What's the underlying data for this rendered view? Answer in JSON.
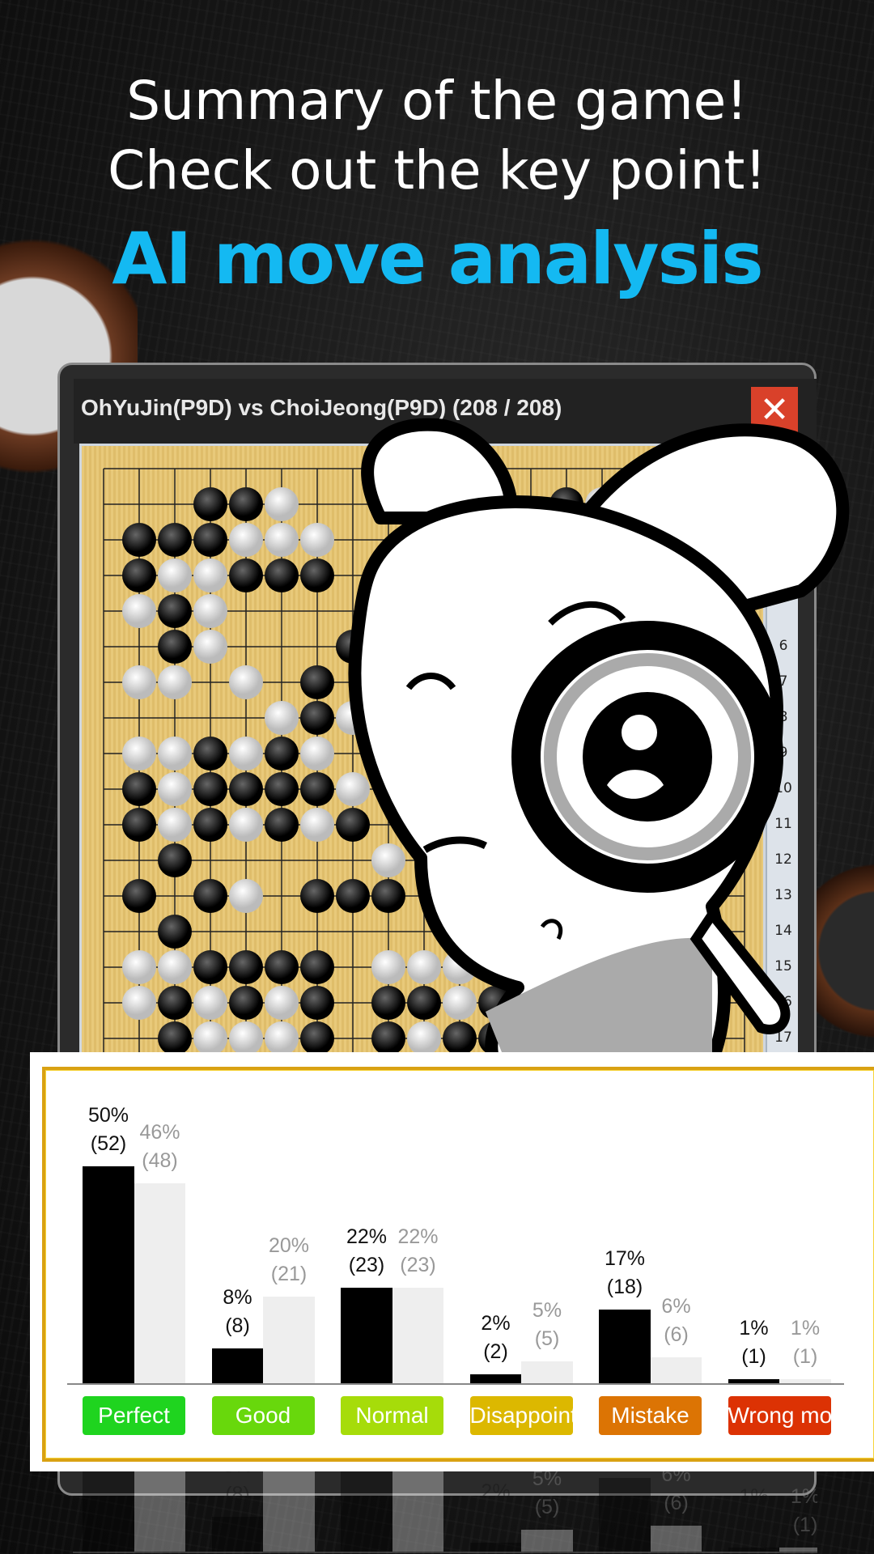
{
  "headline": {
    "line1": "Summary of the game!",
    "line2": "Check out the key point!",
    "line3": "AI move analysis"
  },
  "colors": {
    "accent": "#14b9f2",
    "close": "#d9412a",
    "player_bar": "#000000",
    "opponent_bar": "#eeeeee"
  },
  "window": {
    "title": "OhYuJin(P9D) vs ChoiJeong(P9D) (208 / 208)",
    "close_icon": "close-icon"
  },
  "board": {
    "row_labels": [
      "6",
      "7",
      "8",
      "9",
      "10",
      "11",
      "12",
      "13",
      "14",
      "15",
      "16",
      "17"
    ],
    "rows": [
      "...................",
      "...BBW.......BW....",
      ".BBBWWW............",
      ".BWWBBB............",
      ".WBW...............",
      "..BW...B...........",
      ".WW.W.B............",
      ".....WBW...........",
      ".WWBWBW............",
      ".BWBBBBW...........",
      ".BWBWBWB...........",
      "..B.....W..........",
      ".B.BW.BBB..........",
      "..B................",
      ".WWBBBB.WWWW.......",
      ".WBWBWB.BBWB.......",
      "..BWWWB.BWBB......."
    ]
  },
  "chart_data": {
    "type": "bar",
    "categories": [
      "Perfect",
      "Good",
      "Normal",
      "Disappointing",
      "Mistake",
      "Wrong move"
    ],
    "category_colors": [
      "#1fd41f",
      "#68d80c",
      "#a6dc0a",
      "#dcb800",
      "#dc7404",
      "#dc3204"
    ],
    "series": [
      {
        "percent": [
          50,
          8,
          22,
          2,
          17,
          1
        ],
        "count": [
          52,
          8,
          23,
          2,
          18,
          1
        ],
        "color": "#000000"
      },
      {
        "percent": [
          46,
          20,
          22,
          5,
          6,
          1
        ],
        "count": [
          48,
          21,
          23,
          5,
          6,
          1
        ],
        "color": "#eeeeee"
      }
    ],
    "ylim": [
      0,
      55
    ],
    "grid": false
  }
}
